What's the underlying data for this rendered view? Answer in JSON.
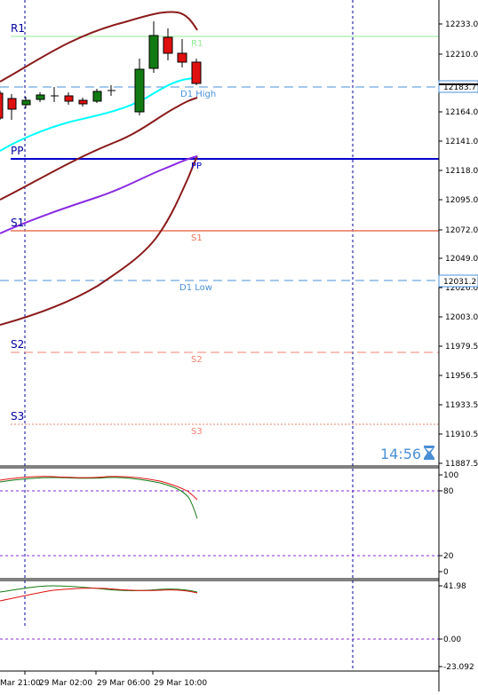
{
  "main_panel": {
    "price_ticks": [
      "12233.0",
      "12210.0",
      "12164.0",
      "12141.0",
      "12118.0",
      "12095.0",
      "12072.0",
      "12049.0",
      "12026.0",
      "12003.0",
      "11979.5",
      "11956.5",
      "11933.5",
      "11910.5",
      "11887.5"
    ],
    "current_price": "12183.7",
    "d1_low_price": "12031.2",
    "levels": {
      "r1_left": "R1",
      "r1_right": "R1",
      "pp_left": "PP",
      "pp_right": "PP",
      "s1_left": "S1",
      "s1_right": "S1",
      "s2_left": "S2",
      "s2_right": "S2",
      "s3_left": "S3",
      "s3_right": "S3",
      "d1_high": "D1 High",
      "d1_low": "D1 Low"
    },
    "timer": "14:56",
    "hourglass": "hourglass-icon"
  },
  "stochastic_panel": {
    "ticks": [
      "100",
      "80",
      "20",
      "0"
    ]
  },
  "oscillator_panel": {
    "ticks": [
      "41.98",
      "0.00",
      "-23.092"
    ]
  },
  "time_axis": {
    "labels": [
      "Mar 21:00",
      "29 Mar 02:00",
      "29 Mar 06:00",
      "29 Mar 10:00"
    ]
  },
  "colors": {
    "r1": "#90ee90",
    "pp": "#0000cd",
    "s1": "#e9765a",
    "s2": "#f08070",
    "s3": "#f08070",
    "d1": "#4a90d9",
    "bollinger": "#8b1a1a",
    "ma_fast": "#00ffff",
    "ma_slow": "#8a2be2",
    "bull": "#127a12",
    "bear": "#e01010",
    "timer": "#4a8fd6"
  }
}
